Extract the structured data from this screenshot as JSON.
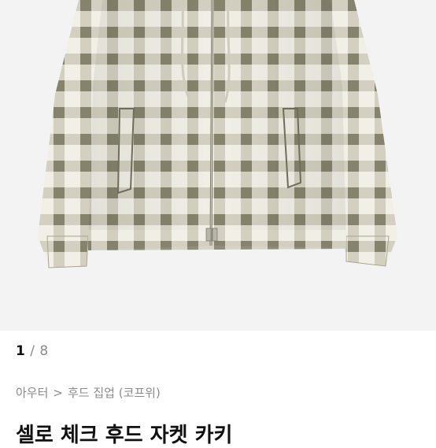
{
  "product_image": {
    "alt": "product-photo",
    "colors": {
      "dark": "#8a8670",
      "light": "#f1efe6",
      "mid": "#bdb9a6",
      "bg": "#f3f3f3"
    }
  },
  "pager": {
    "current": "1",
    "separator": "/",
    "total": "8"
  },
  "breadcrumb": {
    "items": [
      "아우터",
      "후드 집업 (코프위)"
    ],
    "separator": ">"
  },
  "product": {
    "title": "셀로 체크 후드 자켓 카키"
  }
}
